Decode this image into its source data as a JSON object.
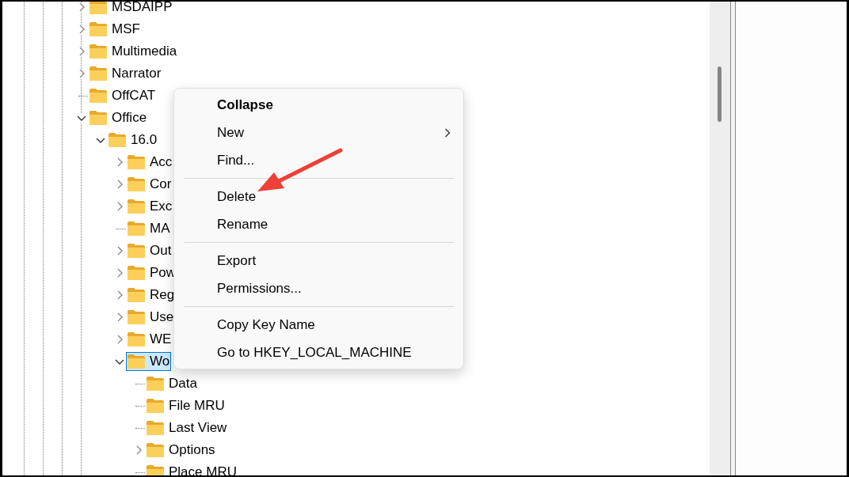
{
  "tree": [
    {
      "label": "MSDAIPP",
      "expanded": false,
      "selected": false
    },
    {
      "label": "MSF",
      "expanded": false,
      "selected": false
    },
    {
      "label": "Multimedia",
      "expanded": false,
      "selected": false
    },
    {
      "label": "Narrator",
      "expanded": false,
      "selected": false
    },
    {
      "label": "OffCAT",
      "selected": false
    },
    {
      "label": "Office",
      "expanded": true,
      "selected": false,
      "children": [
        {
          "label": "16.0",
          "expanded": true,
          "selected": false,
          "children": [
            {
              "label": "Acc",
              "expanded": false,
              "selected": false
            },
            {
              "label": "Cor",
              "expanded": false,
              "selected": false
            },
            {
              "label": "Exc",
              "expanded": false,
              "selected": false
            },
            {
              "label": "MA",
              "selected": false
            },
            {
              "label": "Out",
              "expanded": false,
              "selected": false
            },
            {
              "label": "Pow",
              "expanded": false,
              "selected": false
            },
            {
              "label": "Reg",
              "expanded": false,
              "selected": false
            },
            {
              "label": "Use",
              "expanded": false,
              "selected": false
            },
            {
              "label": "WE",
              "expanded": false,
              "selected": false
            },
            {
              "label": "Wo",
              "expanded": true,
              "selected": true,
              "children": [
                {
                  "label": "Data",
                  "selected": false
                },
                {
                  "label": "File MRU",
                  "selected": false
                },
                {
                  "label": "Last View",
                  "selected": false
                },
                {
                  "label": "Options",
                  "expanded": false,
                  "selected": false
                },
                {
                  "label": "Place MRU",
                  "selected": false
                }
              ]
            }
          ]
        }
      ]
    }
  ],
  "context_menu": [
    {
      "kind": "item",
      "label": "Collapse",
      "default": true
    },
    {
      "kind": "item",
      "label": "New",
      "default": false,
      "submenu": true
    },
    {
      "kind": "item",
      "label": "Find...",
      "default": false
    },
    {
      "kind": "separator"
    },
    {
      "kind": "item",
      "label": "Delete",
      "default": false
    },
    {
      "kind": "item",
      "label": "Rename",
      "default": false
    },
    {
      "kind": "separator"
    },
    {
      "kind": "item",
      "label": "Export",
      "default": false
    },
    {
      "kind": "item",
      "label": "Permissions...",
      "default": false
    },
    {
      "kind": "separator"
    },
    {
      "kind": "item",
      "label": "Copy Key Name",
      "default": false
    },
    {
      "kind": "item",
      "label": "Go to HKEY_LOCAL_MACHINE",
      "default": false
    }
  ]
}
